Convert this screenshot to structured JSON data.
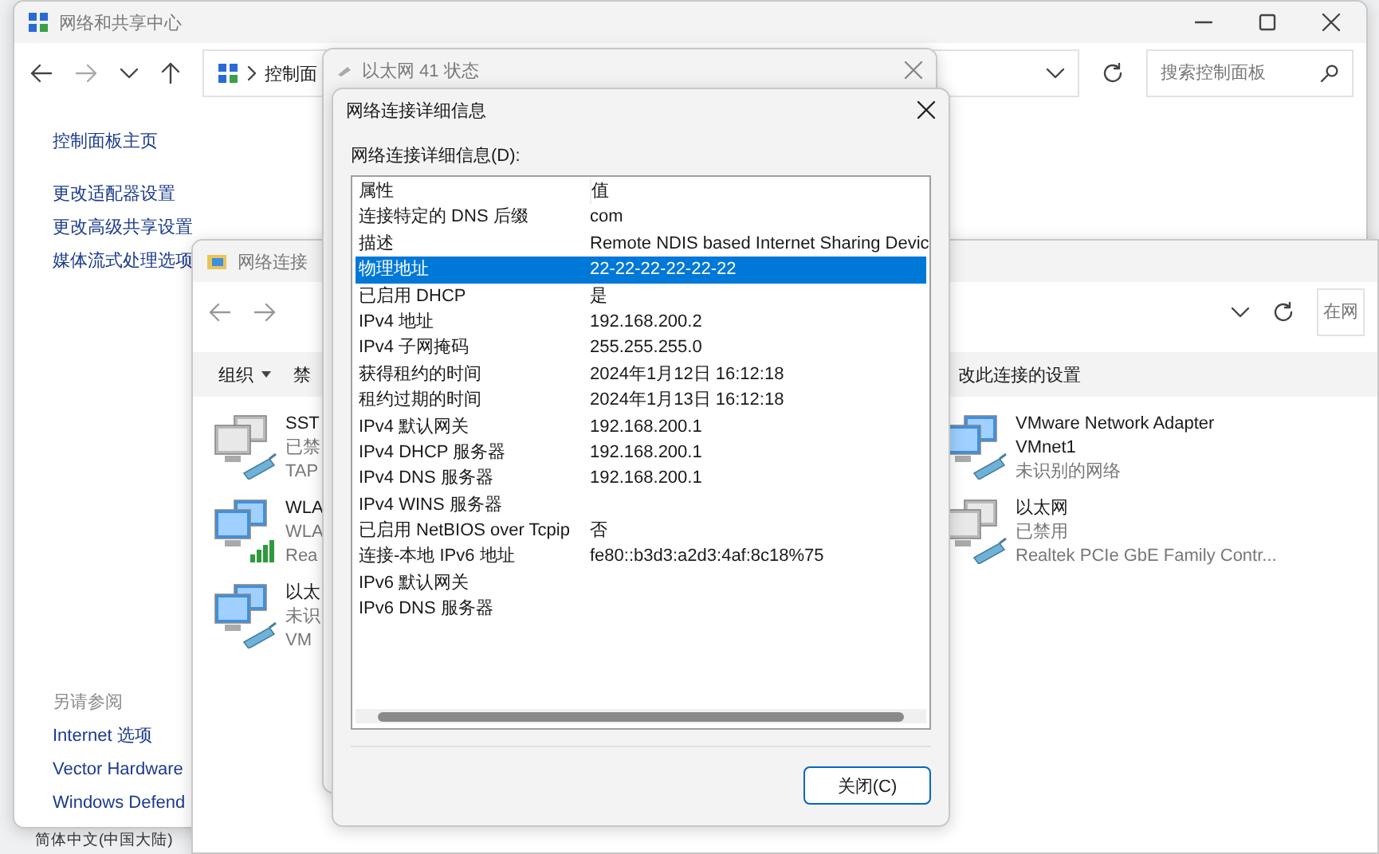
{
  "control_panel": {
    "title": "网络和共享中心",
    "address": "控制面",
    "search_placeholder": "搜索控制面板",
    "home_link": "控制面板主页",
    "task_links": [
      "更改适配器设置",
      "更改高级共享设置",
      "媒体流式处理选项"
    ],
    "see_also": {
      "heading": "另请参阅",
      "links": [
        "Internet 选项",
        "Vector Hardware",
        "Windows Defend"
      ]
    }
  },
  "language_bar": {
    "text": "简体中文(中国大陆)"
  },
  "network_connections": {
    "title": "网络连接",
    "search_placeholder": "在网",
    "toolbar": [
      {
        "label": "组织",
        "kind": "menu"
      },
      {
        "label": "禁",
        "kind": "button"
      }
    ],
    "toolbar_right": "改此连接的设置",
    "adapters": [
      {
        "name": "SST",
        "details": [
          "已禁",
          "TAP"
        ],
        "kind": "wired",
        "disabled": true
      },
      {
        "name": "VMware Network Adapter VMnet1",
        "details": [
          "未识别的网络"
        ],
        "kind": "wired",
        "disabled": false
      },
      {
        "name": "WLA",
        "details": [
          "WLA",
          "Rea"
        ],
        "kind": "wireless",
        "disabled": false
      },
      {
        "name": "以太网",
        "details": [
          "已禁用",
          "Realtek PCIe GbE Family Contr..."
        ],
        "kind": "wired",
        "disabled": true
      },
      {
        "name": "以太",
        "details": [
          "未识",
          "VM"
        ],
        "kind": "wired",
        "disabled": false
      }
    ]
  },
  "status_window": {
    "title": "以太网 41 状态"
  },
  "details_dialog": {
    "title": "网络连接详细信息",
    "list_label": "网络连接详细信息(D):",
    "columns": [
      "属性",
      "值"
    ],
    "rows": [
      {
        "property": "连接特定的 DNS 后缀",
        "value": "com",
        "selected": false
      },
      {
        "property": "描述",
        "value": "Remote NDIS based Internet Sharing Devic",
        "selected": false
      },
      {
        "property": "物理地址",
        "value": "22-22-22-22-22-22",
        "selected": true
      },
      {
        "property": "已启用 DHCP",
        "value": "是",
        "selected": false
      },
      {
        "property": "IPv4 地址",
        "value": "192.168.200.2",
        "selected": false
      },
      {
        "property": "IPv4 子网掩码",
        "value": "255.255.255.0",
        "selected": false
      },
      {
        "property": "获得租约的时间",
        "value": "2024年1月12日 16:12:18",
        "selected": false
      },
      {
        "property": "租约过期的时间",
        "value": "2024年1月13日 16:12:18",
        "selected": false
      },
      {
        "property": "IPv4 默认网关",
        "value": "192.168.200.1",
        "selected": false
      },
      {
        "property": "IPv4 DHCP 服务器",
        "value": "192.168.200.1",
        "selected": false
      },
      {
        "property": "IPv4 DNS 服务器",
        "value": "192.168.200.1",
        "selected": false
      },
      {
        "property": "IPv4 WINS 服务器",
        "selected": false
      },
      {
        "property": "已启用 NetBIOS over Tcpip",
        "value": "否",
        "selected": false
      },
      {
        "property": "连接-本地 IPv6 地址",
        "value": "fe80::b3d3:a2d3:4af:8c18%75",
        "selected": false
      },
      {
        "property": "IPv6 默认网关",
        "selected": false
      },
      {
        "property": "IPv6 DNS 服务器",
        "selected": false
      }
    ],
    "close_button": "关闭(C)"
  }
}
